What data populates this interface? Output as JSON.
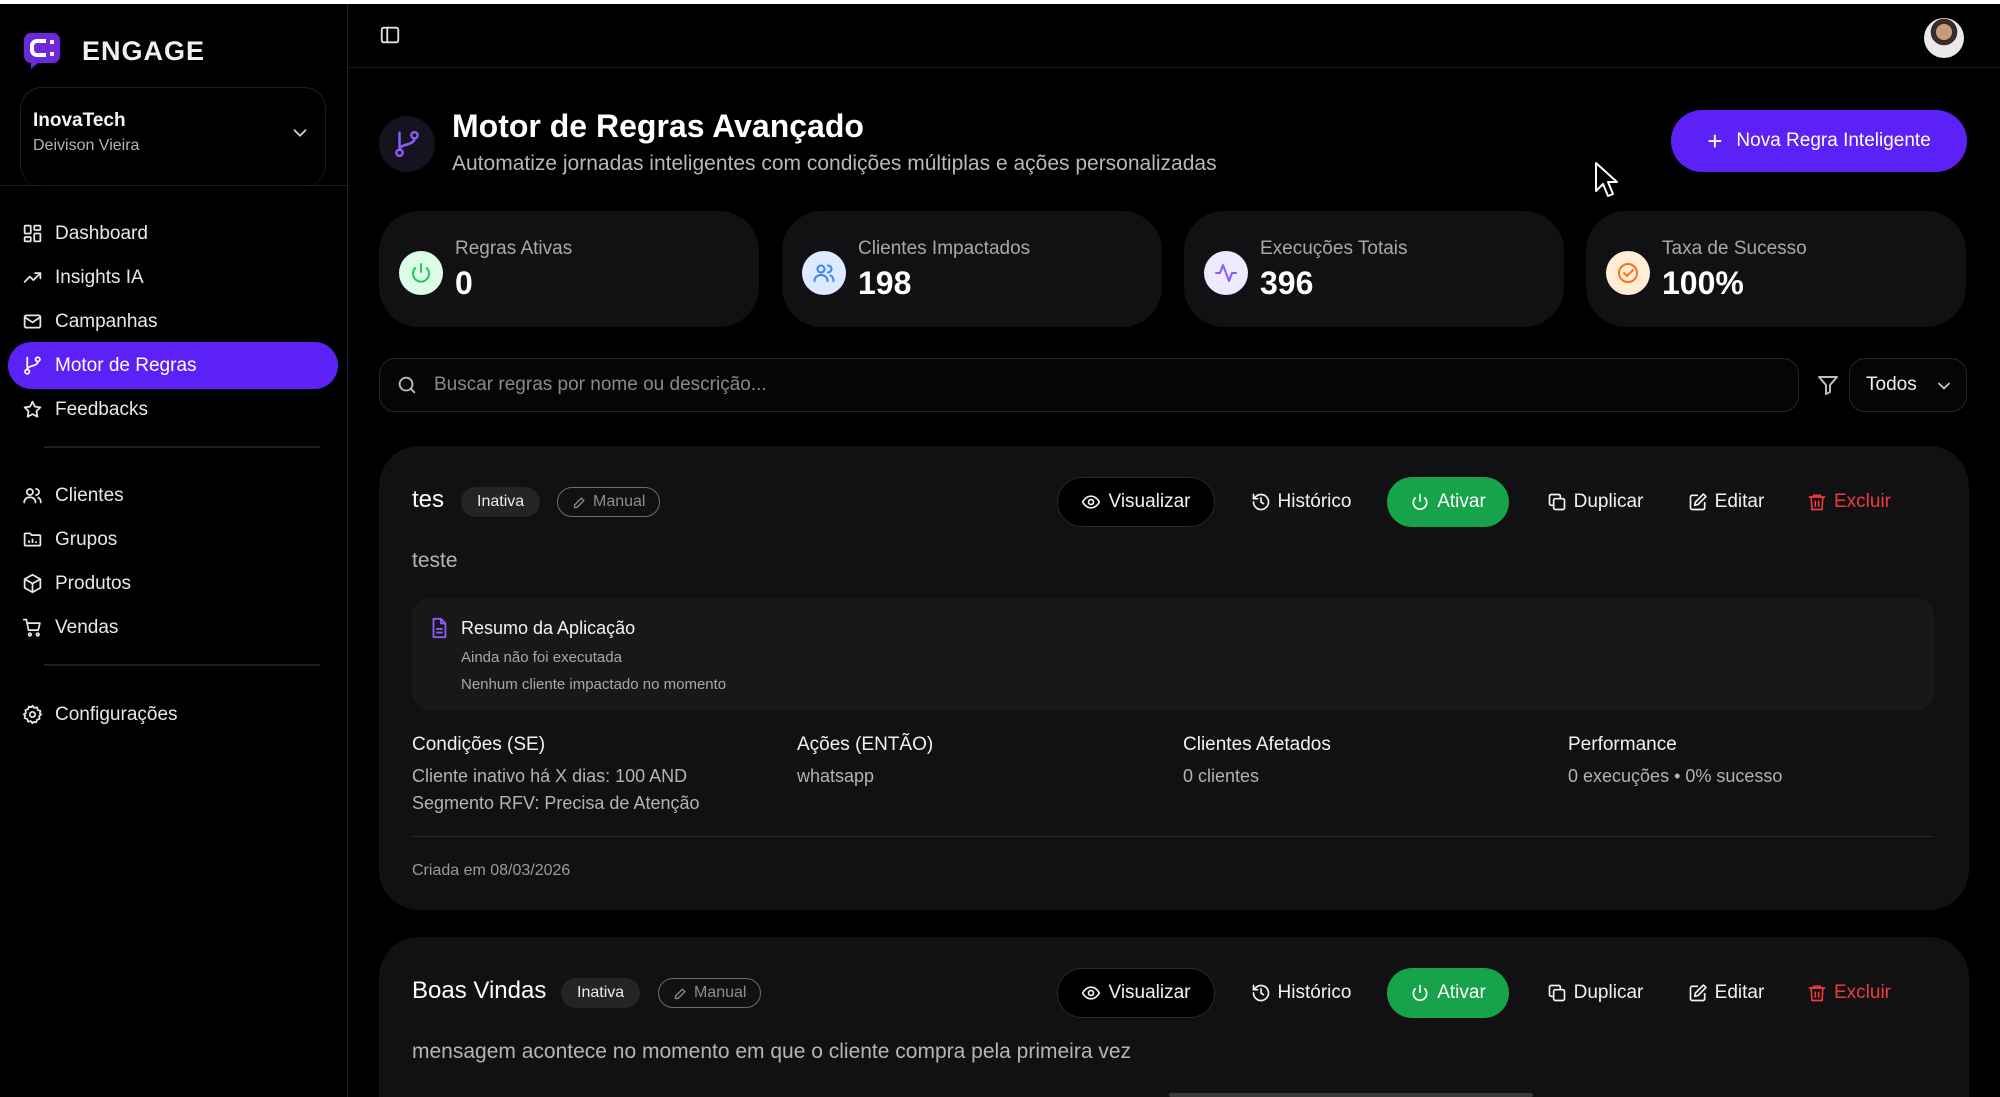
{
  "brand": {
    "name": "ENGAGE"
  },
  "org": {
    "name": "InovaTech",
    "user": "Deivison Vieira"
  },
  "nav": {
    "group1": [
      {
        "label": "Dashboard",
        "icon": "dashboard-icon"
      },
      {
        "label": "Insights IA",
        "icon": "trending-up-icon"
      },
      {
        "label": "Campanhas",
        "icon": "mail-icon"
      },
      {
        "label": "Motor de Regras",
        "icon": "git-branch-icon",
        "active": true
      },
      {
        "label": "Feedbacks",
        "icon": "star-icon"
      }
    ],
    "group2": [
      {
        "label": "Clientes",
        "icon": "users-icon"
      },
      {
        "label": "Grupos",
        "icon": "folder-icon"
      },
      {
        "label": "Produtos",
        "icon": "package-icon"
      },
      {
        "label": "Vendas",
        "icon": "cart-icon"
      }
    ],
    "group3": [
      {
        "label": "Configurações",
        "icon": "gear-icon"
      }
    ]
  },
  "header": {
    "title": "Motor de Regras Avançado",
    "subtitle": "Automatize jornadas inteligentes com condições múltiplas e ações personalizadas",
    "new_rule_label": "Nova Regra Inteligente"
  },
  "stats": [
    {
      "label": "Regras Ativas",
      "value": "0",
      "icon": "power-icon",
      "color": "#22c55e",
      "bg": "#dcfce7"
    },
    {
      "label": "Clientes Impactados",
      "value": "198",
      "icon": "users-icon",
      "color": "#3b82f6",
      "bg": "#dbeafe"
    },
    {
      "label": "Execuções Totais",
      "value": "396",
      "icon": "activity-icon",
      "color": "#8b5cf6",
      "bg": "#ede9fe"
    },
    {
      "label": "Taxa de Sucesso",
      "value": "100%",
      "icon": "target-icon",
      "color": "#f97316",
      "bg": "#ffedd5"
    }
  ],
  "search": {
    "placeholder": "Buscar regras por nome ou descrição..."
  },
  "filter": {
    "selected": "Todos"
  },
  "actions": {
    "view": "Visualizar",
    "history": "Histórico",
    "activate": "Ativar",
    "duplicate": "Duplicar",
    "edit": "Editar",
    "delete": "Excluir"
  },
  "rules": [
    {
      "name": "tes",
      "status": "Inativa",
      "mode": "Manual",
      "description": "teste",
      "summary": {
        "title": "Resumo da Aplicação",
        "line1": "Ainda não foi executada",
        "line2": "Nenhum cliente impactado no momento"
      },
      "conditions": {
        "label": "Condições (SE)",
        "line1": "Cliente inativo há X dias: 100 AND",
        "line2": "Segmento RFV: Precisa de Atenção"
      },
      "actions_col": {
        "label": "Ações (ENTÃO)",
        "value": "whatsapp"
      },
      "clients": {
        "label": "Clientes Afetados",
        "value": "0 clientes"
      },
      "performance": {
        "label": "Performance",
        "value": "0 execuções • 0% sucesso"
      },
      "created": "Criada em 08/03/2026"
    },
    {
      "name": "Boas Vindas",
      "status": "Inativa",
      "mode": "Manual",
      "description": "mensagem acontece no momento em que o cliente compra pela primeira vez"
    }
  ],
  "colors": {
    "accent": "#5b21f6",
    "success": "#16a34a",
    "danger": "#ef3b3b",
    "background": "#000000",
    "card": "#111113"
  }
}
